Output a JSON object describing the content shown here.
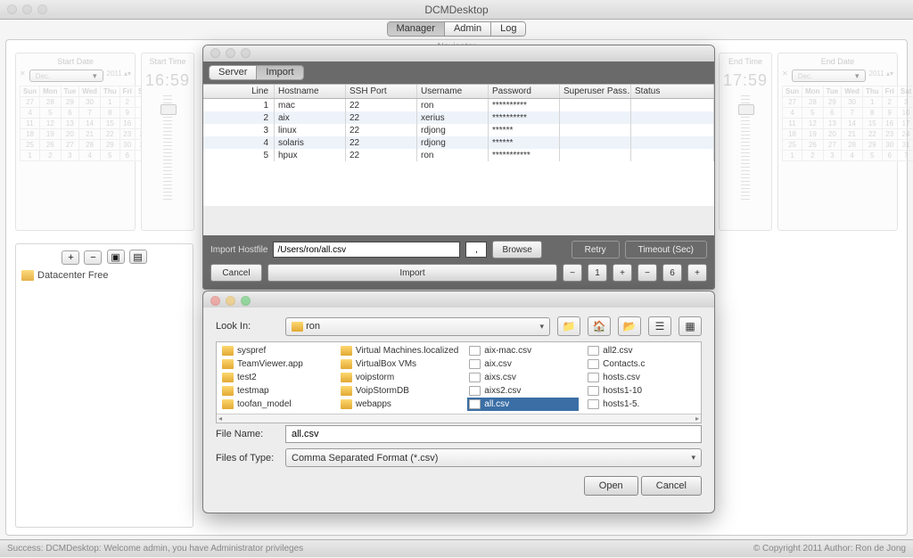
{
  "window": {
    "title": "DCMDesktop",
    "navigator_label": "Navigator"
  },
  "main_tabs": {
    "manager": "Manager",
    "admin": "Admin",
    "log": "Log"
  },
  "panels": {
    "start_date": "Start Date",
    "start_time": "Start Time",
    "end_time": "End Time",
    "end_date": "End Date",
    "time1": "16:59",
    "time2": "17:59",
    "month": "Dec.",
    "dow": [
      "Sun",
      "Mon",
      "Tue",
      "Wed",
      "Thu",
      "Fri",
      "Sat"
    ]
  },
  "tree": {
    "buttons": {
      "add": "+",
      "remove": "−",
      "b1": "▣",
      "b2": "▤"
    },
    "root": "Datacenter Free"
  },
  "server_win": {
    "tabs": {
      "server": "Server",
      "import": "Import"
    },
    "cols": {
      "line": "Line",
      "host": "Hostname",
      "ssh": "SSH Port",
      "user": "Username",
      "pass": "Password",
      "su": "Superuser Pass…",
      "stat": "Status"
    },
    "rows": [
      {
        "n": "1",
        "host": "mac",
        "ssh": "22",
        "user": "ron",
        "pass": "**********"
      },
      {
        "n": "2",
        "host": "aix",
        "ssh": "22",
        "user": "xerius",
        "pass": "**********"
      },
      {
        "n": "3",
        "host": "linux",
        "ssh": "22",
        "user": "rdjong",
        "pass": "******"
      },
      {
        "n": "4",
        "host": "solaris",
        "ssh": "22",
        "user": "rdjong",
        "pass": "******"
      },
      {
        "n": "5",
        "host": "hpux",
        "ssh": "22",
        "user": "ron",
        "pass": "***********"
      }
    ],
    "import_label": "Import Hostfile",
    "path": "/Users/ron/all.csv",
    "sep": ",",
    "browse": "Browse",
    "retry": "Retry",
    "timeout": "Timeout (Sec)",
    "cancel": "Cancel",
    "import": "Import",
    "minus": "−",
    "plus": "+",
    "v1": "1",
    "v2": "6"
  },
  "file_dlg": {
    "lookin_label": "Look In:",
    "lookin_value": "ron",
    "cols": [
      [
        {
          "t": "syspref",
          "f": true
        },
        {
          "t": "TeamViewer.app",
          "f": true
        },
        {
          "t": "test2",
          "f": true
        },
        {
          "t": "testmap",
          "f": true
        },
        {
          "t": "toofan_model",
          "f": true
        }
      ],
      [
        {
          "t": "Virtual Machines.localized",
          "f": true
        },
        {
          "t": "VirtualBox VMs",
          "f": true
        },
        {
          "t": "voipstorm",
          "f": true
        },
        {
          "t": "VoipStormDB",
          "f": true
        },
        {
          "t": "webapps",
          "f": true
        }
      ],
      [
        {
          "t": "aix-mac.csv"
        },
        {
          "t": "aix.csv"
        },
        {
          "t": "aixs.csv"
        },
        {
          "t": "aixs2.csv"
        },
        {
          "t": "all.csv",
          "sel": true
        }
      ],
      [
        {
          "t": "all2.csv"
        },
        {
          "t": "Contacts.c"
        },
        {
          "t": "hosts.csv"
        },
        {
          "t": "hosts1-10"
        },
        {
          "t": "hosts1-5."
        }
      ]
    ],
    "filename_label": "File Name:",
    "filename": "all.csv",
    "type_label": "Files of Type:",
    "type_value": "Comma Separated Format (*.csv)",
    "open": "Open",
    "cancel": "Cancel"
  },
  "status": {
    "left": "Success: DCMDesktop: Welcome admin, you have Administrator privileges",
    "right": "© Copyright 2011 Author: Ron de Jong"
  }
}
